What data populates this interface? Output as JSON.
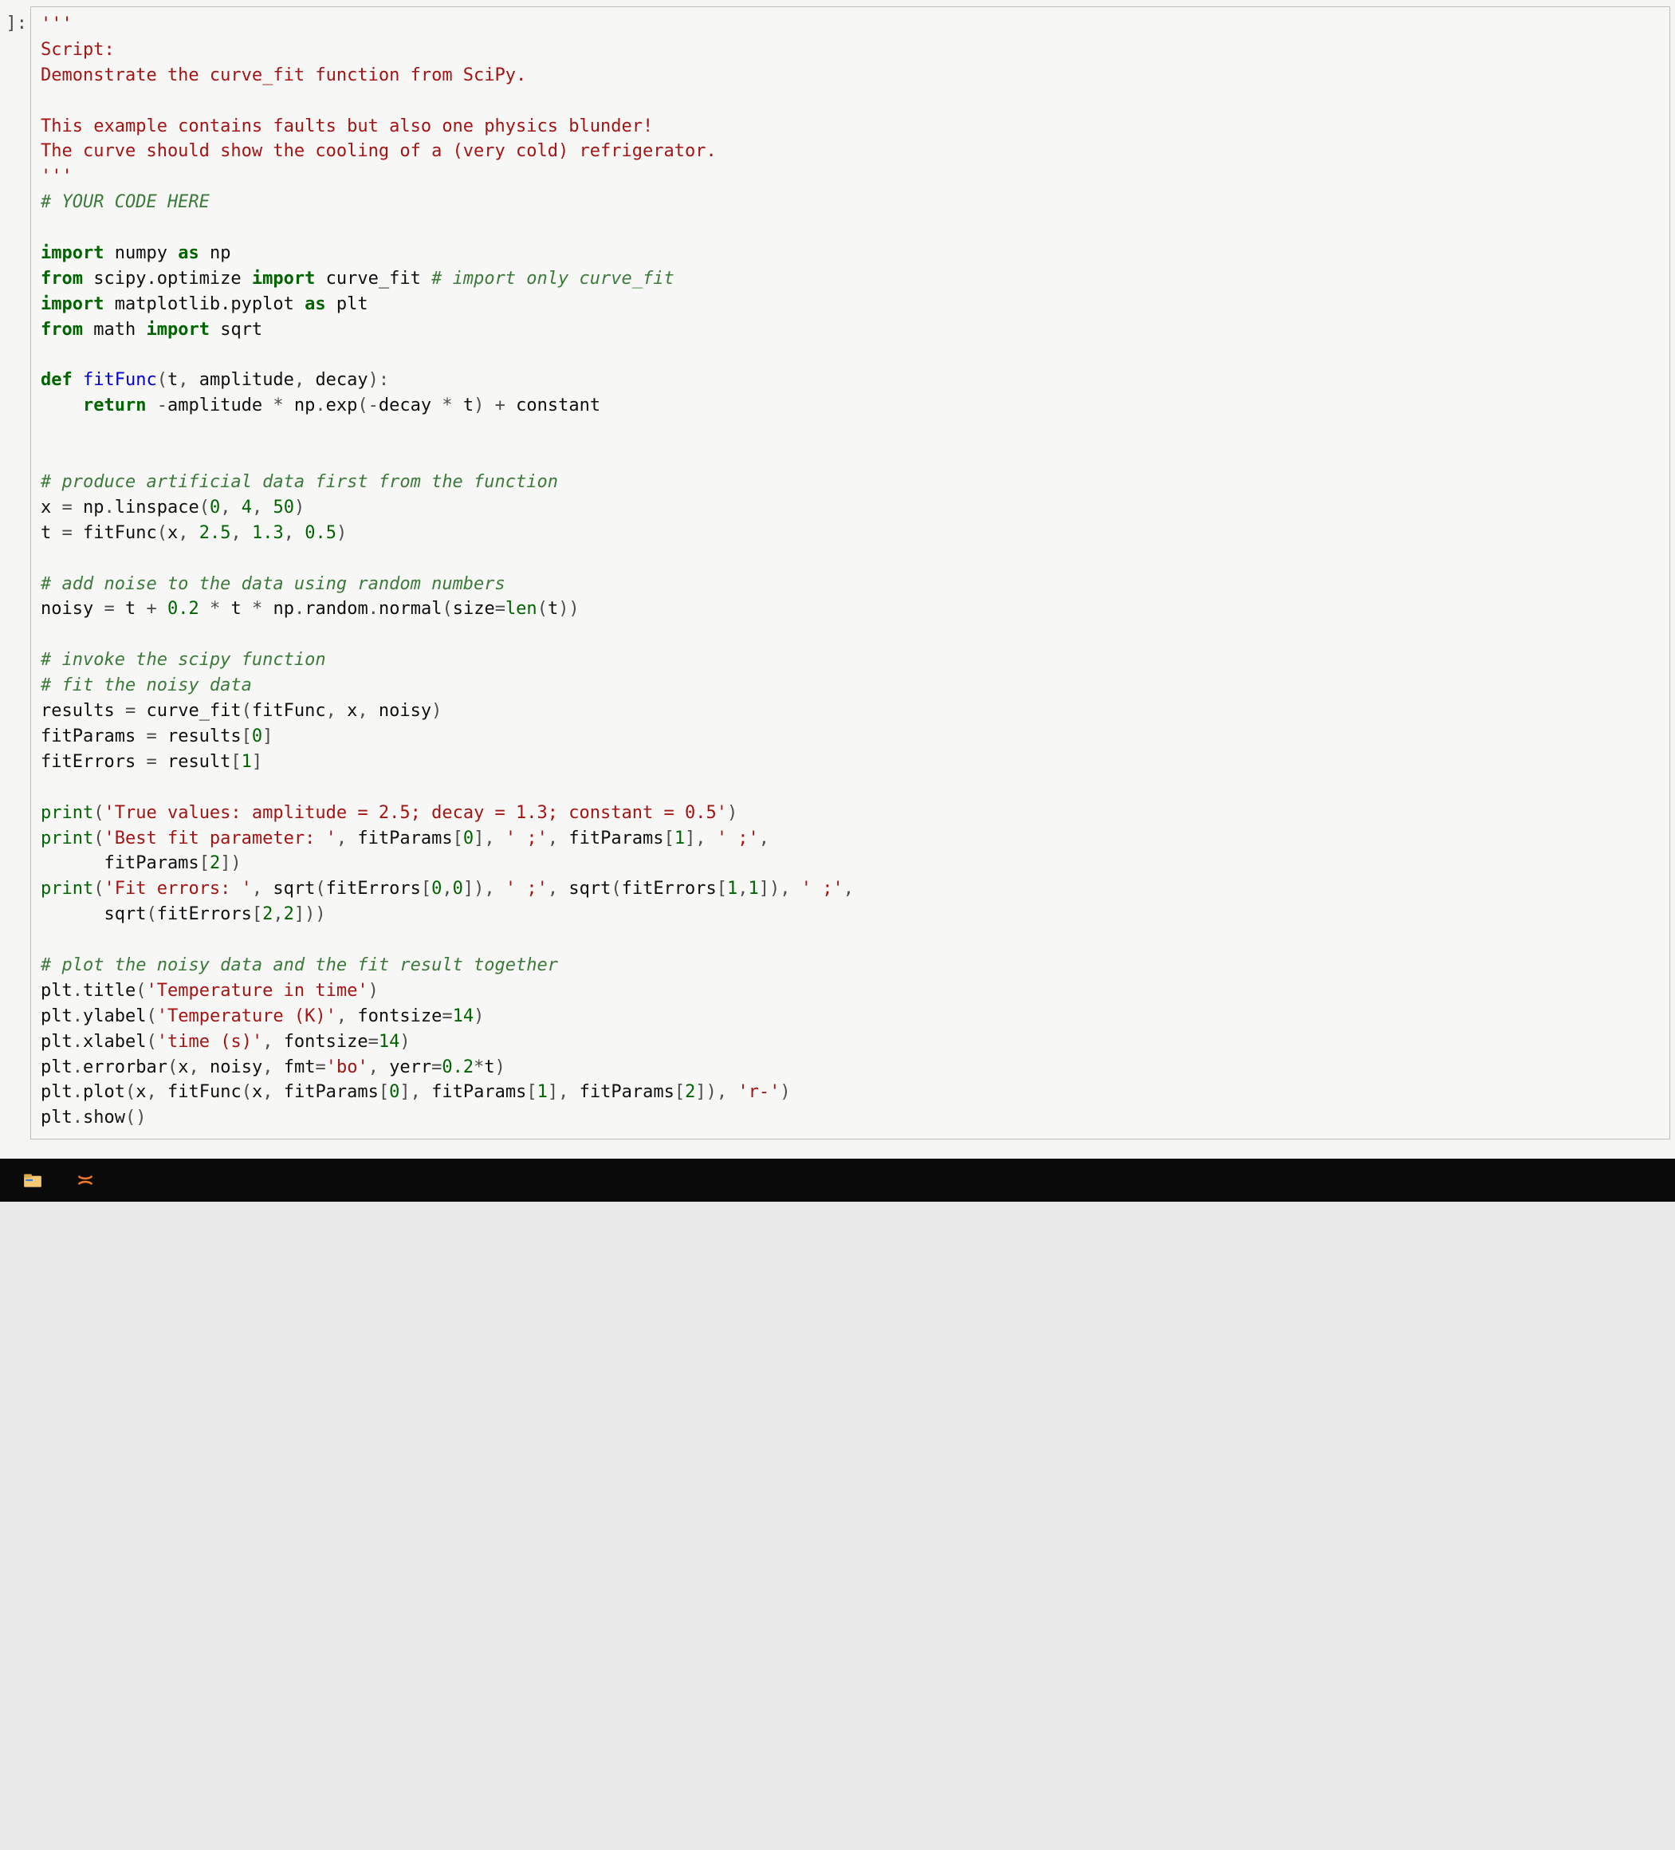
{
  "prompt": "]:",
  "code_lines": [
    [
      [
        "str",
        "'''"
      ]
    ],
    [
      [
        "str",
        "Script:"
      ]
    ],
    [
      [
        "str",
        "Demonstrate the curve_fit function from SciPy."
      ]
    ],
    [
      [
        "str",
        ""
      ]
    ],
    [
      [
        "str",
        "This example contains faults but also one physics blunder!"
      ]
    ],
    [
      [
        "str",
        "The curve should show the cooling of a (very cold) refrigerator."
      ]
    ],
    [
      [
        "str",
        "'''"
      ]
    ],
    [
      [
        "com",
        "# YOUR CODE HERE"
      ]
    ],
    [
      [
        "id",
        ""
      ]
    ],
    [
      [
        "kw",
        "import"
      ],
      [
        "id",
        " numpy "
      ],
      [
        "kw",
        "as"
      ],
      [
        "id",
        " np"
      ]
    ],
    [
      [
        "kw",
        "from"
      ],
      [
        "id",
        " scipy.optimize "
      ],
      [
        "kw",
        "import"
      ],
      [
        "id",
        " curve_fit "
      ],
      [
        "com",
        "# import only curve_fit"
      ]
    ],
    [
      [
        "kw",
        "import"
      ],
      [
        "id",
        " matplotlib.pyplot "
      ],
      [
        "kw",
        "as"
      ],
      [
        "id",
        " plt"
      ]
    ],
    [
      [
        "kw",
        "from"
      ],
      [
        "id",
        " math "
      ],
      [
        "kw",
        "import"
      ],
      [
        "id",
        " sqrt"
      ]
    ],
    [
      [
        "id",
        ""
      ]
    ],
    [
      [
        "kw",
        "def"
      ],
      [
        "id",
        " "
      ],
      [
        "fn",
        "fitFunc"
      ],
      [
        "op",
        "("
      ],
      [
        "id",
        "t"
      ],
      [
        "op",
        ", "
      ],
      [
        "id",
        "amplitude"
      ],
      [
        "op",
        ", "
      ],
      [
        "id",
        "decay"
      ],
      [
        "op",
        "):"
      ]
    ],
    [
      [
        "id",
        "    "
      ],
      [
        "kw",
        "return"
      ],
      [
        "id",
        " "
      ],
      [
        "op",
        "-"
      ],
      [
        "id",
        "amplitude "
      ],
      [
        "op",
        "*"
      ],
      [
        "id",
        " np"
      ],
      [
        "op",
        "."
      ],
      [
        "id",
        "exp"
      ],
      [
        "op",
        "(-"
      ],
      [
        "id",
        "decay "
      ],
      [
        "op",
        "*"
      ],
      [
        "id",
        " t"
      ],
      [
        "op",
        ") + "
      ],
      [
        "id",
        "constant"
      ]
    ],
    [
      [
        "id",
        ""
      ]
    ],
    [
      [
        "id",
        ""
      ]
    ],
    [
      [
        "com",
        "# produce artificial data first from the function"
      ]
    ],
    [
      [
        "id",
        "x "
      ],
      [
        "op",
        "="
      ],
      [
        "id",
        " np"
      ],
      [
        "op",
        "."
      ],
      [
        "id",
        "linspace"
      ],
      [
        "op",
        "("
      ],
      [
        "num",
        "0"
      ],
      [
        "op",
        ", "
      ],
      [
        "num",
        "4"
      ],
      [
        "op",
        ", "
      ],
      [
        "num",
        "50"
      ],
      [
        "op",
        ")"
      ]
    ],
    [
      [
        "id",
        "t "
      ],
      [
        "op",
        "="
      ],
      [
        "id",
        " fitFunc"
      ],
      [
        "op",
        "("
      ],
      [
        "id",
        "x"
      ],
      [
        "op",
        ", "
      ],
      [
        "num",
        "2.5"
      ],
      [
        "op",
        ", "
      ],
      [
        "num",
        "1.3"
      ],
      [
        "op",
        ", "
      ],
      [
        "num",
        "0.5"
      ],
      [
        "op",
        ")"
      ]
    ],
    [
      [
        "id",
        ""
      ]
    ],
    [
      [
        "com",
        "# add noise to the data using random numbers"
      ]
    ],
    [
      [
        "id",
        "noisy "
      ],
      [
        "op",
        "="
      ],
      [
        "id",
        " t "
      ],
      [
        "op",
        "+"
      ],
      [
        "id",
        " "
      ],
      [
        "num",
        "0.2"
      ],
      [
        "id",
        " "
      ],
      [
        "op",
        "*"
      ],
      [
        "id",
        " t "
      ],
      [
        "op",
        "*"
      ],
      [
        "id",
        " np"
      ],
      [
        "op",
        "."
      ],
      [
        "id",
        "random"
      ],
      [
        "op",
        "."
      ],
      [
        "id",
        "normal"
      ],
      [
        "op",
        "("
      ],
      [
        "id",
        "size"
      ],
      [
        "op",
        "="
      ],
      [
        "bltn",
        "len"
      ],
      [
        "op",
        "("
      ],
      [
        "id",
        "t"
      ],
      [
        "op",
        "))"
      ]
    ],
    [
      [
        "id",
        ""
      ]
    ],
    [
      [
        "com",
        "# invoke the scipy function"
      ]
    ],
    [
      [
        "com",
        "# fit the noisy data"
      ]
    ],
    [
      [
        "id",
        "results "
      ],
      [
        "op",
        "="
      ],
      [
        "id",
        " curve_fit"
      ],
      [
        "op",
        "("
      ],
      [
        "id",
        "fitFunc"
      ],
      [
        "op",
        ", "
      ],
      [
        "id",
        "x"
      ],
      [
        "op",
        ", "
      ],
      [
        "id",
        "noisy"
      ],
      [
        "op",
        ")"
      ]
    ],
    [
      [
        "id",
        "fitParams "
      ],
      [
        "op",
        "="
      ],
      [
        "id",
        " results"
      ],
      [
        "op",
        "["
      ],
      [
        "num",
        "0"
      ],
      [
        "op",
        "]"
      ]
    ],
    [
      [
        "id",
        "fitErrors "
      ],
      [
        "op",
        "="
      ],
      [
        "id",
        " result"
      ],
      [
        "op",
        "["
      ],
      [
        "num",
        "1"
      ],
      [
        "op",
        "]"
      ]
    ],
    [
      [
        "id",
        ""
      ]
    ],
    [
      [
        "bltn",
        "print"
      ],
      [
        "op",
        "("
      ],
      [
        "str",
        "'True values: amplitude = 2.5; decay = 1.3; constant = 0.5'"
      ],
      [
        "op",
        ")"
      ]
    ],
    [
      [
        "bltn",
        "print"
      ],
      [
        "op",
        "("
      ],
      [
        "str",
        "'Best fit parameter: '"
      ],
      [
        "op",
        ", "
      ],
      [
        "id",
        "fitParams"
      ],
      [
        "op",
        "["
      ],
      [
        "num",
        "0"
      ],
      [
        "op",
        "], "
      ],
      [
        "str",
        "' ;'"
      ],
      [
        "op",
        ", "
      ],
      [
        "id",
        "fitParams"
      ],
      [
        "op",
        "["
      ],
      [
        "num",
        "1"
      ],
      [
        "op",
        "], "
      ],
      [
        "str",
        "' ;'"
      ],
      [
        "op",
        ","
      ]
    ],
    [
      [
        "id",
        "      fitParams"
      ],
      [
        "op",
        "["
      ],
      [
        "num",
        "2"
      ],
      [
        "op",
        "])"
      ]
    ],
    [
      [
        "bltn",
        "print"
      ],
      [
        "op",
        "("
      ],
      [
        "str",
        "'Fit errors: '"
      ],
      [
        "op",
        ", "
      ],
      [
        "id",
        "sqrt"
      ],
      [
        "op",
        "("
      ],
      [
        "id",
        "fitErrors"
      ],
      [
        "op",
        "["
      ],
      [
        "num",
        "0"
      ],
      [
        "op",
        ","
      ],
      [
        "num",
        "0"
      ],
      [
        "op",
        "]), "
      ],
      [
        "str",
        "' ;'"
      ],
      [
        "op",
        ", "
      ],
      [
        "id",
        "sqrt"
      ],
      [
        "op",
        "("
      ],
      [
        "id",
        "fitErrors"
      ],
      [
        "op",
        "["
      ],
      [
        "num",
        "1"
      ],
      [
        "op",
        ","
      ],
      [
        "num",
        "1"
      ],
      [
        "op",
        "]), "
      ],
      [
        "str",
        "' ;'"
      ],
      [
        "op",
        ","
      ]
    ],
    [
      [
        "id",
        "      sqrt"
      ],
      [
        "op",
        "("
      ],
      [
        "id",
        "fitErrors"
      ],
      [
        "op",
        "["
      ],
      [
        "num",
        "2"
      ],
      [
        "op",
        ","
      ],
      [
        "num",
        "2"
      ],
      [
        "op",
        "]))"
      ]
    ],
    [
      [
        "id",
        ""
      ]
    ],
    [
      [
        "com",
        "# plot the noisy data and the fit result together"
      ]
    ],
    [
      [
        "id",
        "plt"
      ],
      [
        "op",
        "."
      ],
      [
        "id",
        "title"
      ],
      [
        "op",
        "("
      ],
      [
        "str",
        "'Temperature in time'"
      ],
      [
        "op",
        ")"
      ]
    ],
    [
      [
        "id",
        "plt"
      ],
      [
        "op",
        "."
      ],
      [
        "id",
        "ylabel"
      ],
      [
        "op",
        "("
      ],
      [
        "str",
        "'Temperature (K)'"
      ],
      [
        "op",
        ", "
      ],
      [
        "id",
        "fontsize"
      ],
      [
        "op",
        "="
      ],
      [
        "num",
        "14"
      ],
      [
        "op",
        ")"
      ]
    ],
    [
      [
        "id",
        "plt"
      ],
      [
        "op",
        "."
      ],
      [
        "id",
        "xlabel"
      ],
      [
        "op",
        "("
      ],
      [
        "str",
        "'time (s)'"
      ],
      [
        "op",
        ", "
      ],
      [
        "id",
        "fontsize"
      ],
      [
        "op",
        "="
      ],
      [
        "num",
        "14"
      ],
      [
        "op",
        ")"
      ]
    ],
    [
      [
        "id",
        "plt"
      ],
      [
        "op",
        "."
      ],
      [
        "id",
        "errorbar"
      ],
      [
        "op",
        "("
      ],
      [
        "id",
        "x"
      ],
      [
        "op",
        ", "
      ],
      [
        "id",
        "noisy"
      ],
      [
        "op",
        ", "
      ],
      [
        "id",
        "fmt"
      ],
      [
        "op",
        "="
      ],
      [
        "str",
        "'bo'"
      ],
      [
        "op",
        ", "
      ],
      [
        "id",
        "yerr"
      ],
      [
        "op",
        "="
      ],
      [
        "num",
        "0.2"
      ],
      [
        "op",
        "*"
      ],
      [
        "id",
        "t"
      ],
      [
        "op",
        ")"
      ]
    ],
    [
      [
        "id",
        "plt"
      ],
      [
        "op",
        "."
      ],
      [
        "id",
        "plot"
      ],
      [
        "op",
        "("
      ],
      [
        "id",
        "x"
      ],
      [
        "op",
        ", "
      ],
      [
        "id",
        "fitFunc"
      ],
      [
        "op",
        "("
      ],
      [
        "id",
        "x"
      ],
      [
        "op",
        ", "
      ],
      [
        "id",
        "fitParams"
      ],
      [
        "op",
        "["
      ],
      [
        "num",
        "0"
      ],
      [
        "op",
        "], "
      ],
      [
        "id",
        "fitParams"
      ],
      [
        "op",
        "["
      ],
      [
        "num",
        "1"
      ],
      [
        "op",
        "], "
      ],
      [
        "id",
        "fitParams"
      ],
      [
        "op",
        "["
      ],
      [
        "num",
        "2"
      ],
      [
        "op",
        "]), "
      ],
      [
        "str",
        "'r-'"
      ],
      [
        "op",
        ")"
      ]
    ],
    [
      [
        "id",
        "plt"
      ],
      [
        "op",
        "."
      ],
      [
        "id",
        "show"
      ],
      [
        "op",
        "()"
      ]
    ]
  ]
}
